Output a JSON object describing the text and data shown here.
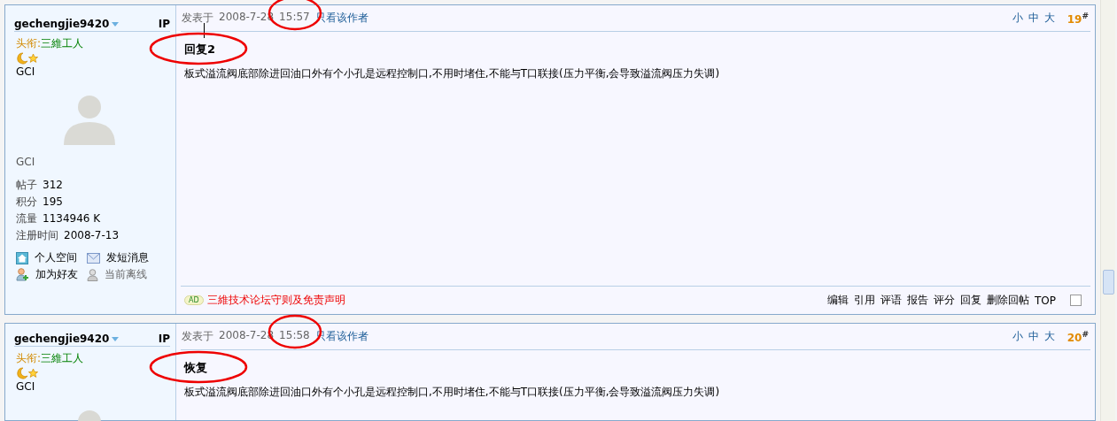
{
  "posts": [
    {
      "username": "gechengjie9420",
      "ip": "IP",
      "rank_label": "头衔:",
      "rank_name": "三維工人",
      "group": "GCI",
      "avatar": true,
      "group_caption": "GCI",
      "stats": [
        {
          "label": "帖子",
          "value": "312"
        },
        {
          "label": "积分",
          "value": "195"
        },
        {
          "label": "流量",
          "value": "1134946 K"
        },
        {
          "label": "注册时间",
          "value": "2008-7-13"
        }
      ],
      "actions": [
        {
          "kind": "home",
          "label": "个人空间"
        },
        {
          "kind": "mail",
          "label": "发短消息"
        },
        {
          "kind": "add",
          "label": "加为好友"
        },
        {
          "kind": "offline",
          "label": "当前离线"
        }
      ],
      "posted_label": "发表于",
      "date": "2008-7-28",
      "time": "15:57",
      "author_only": "只看该作者",
      "font_sizes": [
        "小",
        "中",
        "大"
      ],
      "floor": "19",
      "floor_mark": "#",
      "subject": "回复2",
      "body": "板式溢流阀底部除进回油口外有个小孔是远程控制口,不用时堵住,不能与T口联接(压力平衡,会导致溢流阀压力失调)",
      "ad_label": "AD",
      "ad_link": "三維技术论坛守则及免责声明",
      "tools": [
        "编辑",
        "引用",
        "评语",
        "报告",
        "评分",
        "回复",
        "删除回帖",
        "TOP"
      ],
      "select_checked": false,
      "annotations": [
        {
          "kind": "time"
        },
        {
          "kind": "subject"
        },
        {
          "kind": "leader"
        }
      ]
    },
    {
      "username": "gechengjie9420",
      "ip": "IP",
      "rank_label": "头衔:",
      "rank_name": "三維工人",
      "group": "GCI",
      "avatar": true,
      "posted_label": "发表于",
      "date": "2008-7-28",
      "time": "15:58",
      "author_only": "只看该作者",
      "font_sizes": [
        "小",
        "中",
        "大"
      ],
      "floor": "20",
      "floor_mark": "#",
      "subject": "恢复",
      "body": "板式溢流阀底部除进回油口外有个小孔是远程控制口,不用时堵住,不能与T口联接(压力平衡,会导致溢流阀压力失调)",
      "annotations": [
        {
          "kind": "time"
        },
        {
          "kind": "subject"
        }
      ]
    }
  ]
}
